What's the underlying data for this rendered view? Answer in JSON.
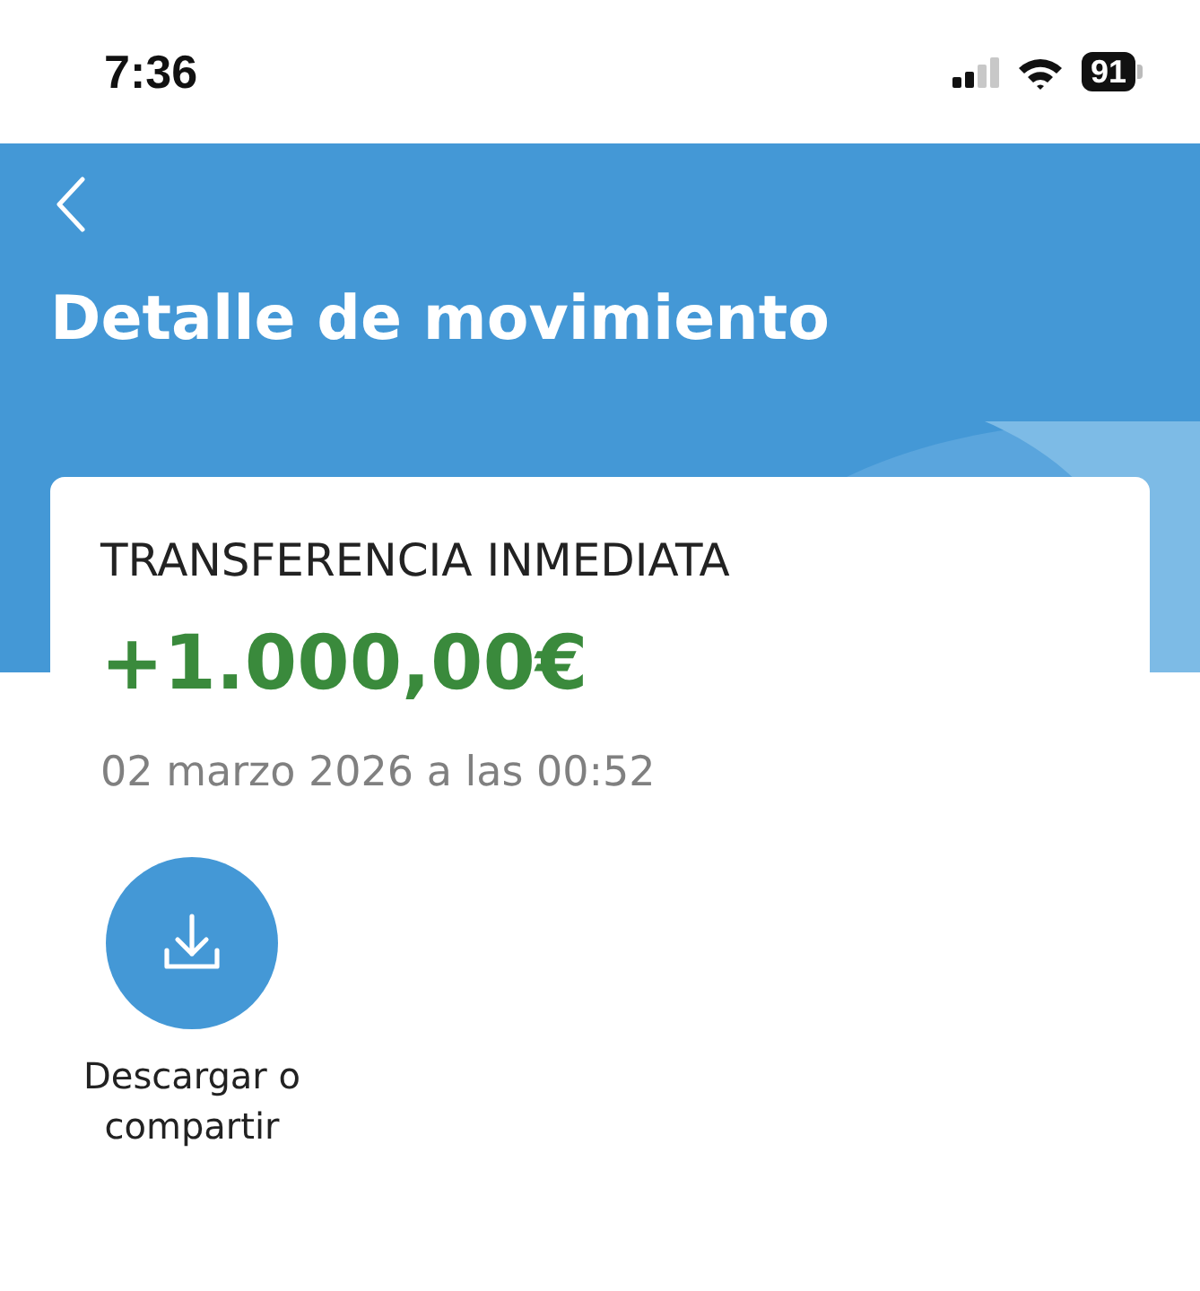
{
  "status_bar": {
    "time": "7:36",
    "battery": "91"
  },
  "header": {
    "title": "Detalle de movimiento"
  },
  "movement": {
    "type": "TRANSFERENCIA INMEDIATA",
    "amount": "+1.000,00€",
    "date": "02 marzo 2026 a las 00:52"
  },
  "actions": [
    {
      "label": "Descargar o compartir"
    }
  ]
}
